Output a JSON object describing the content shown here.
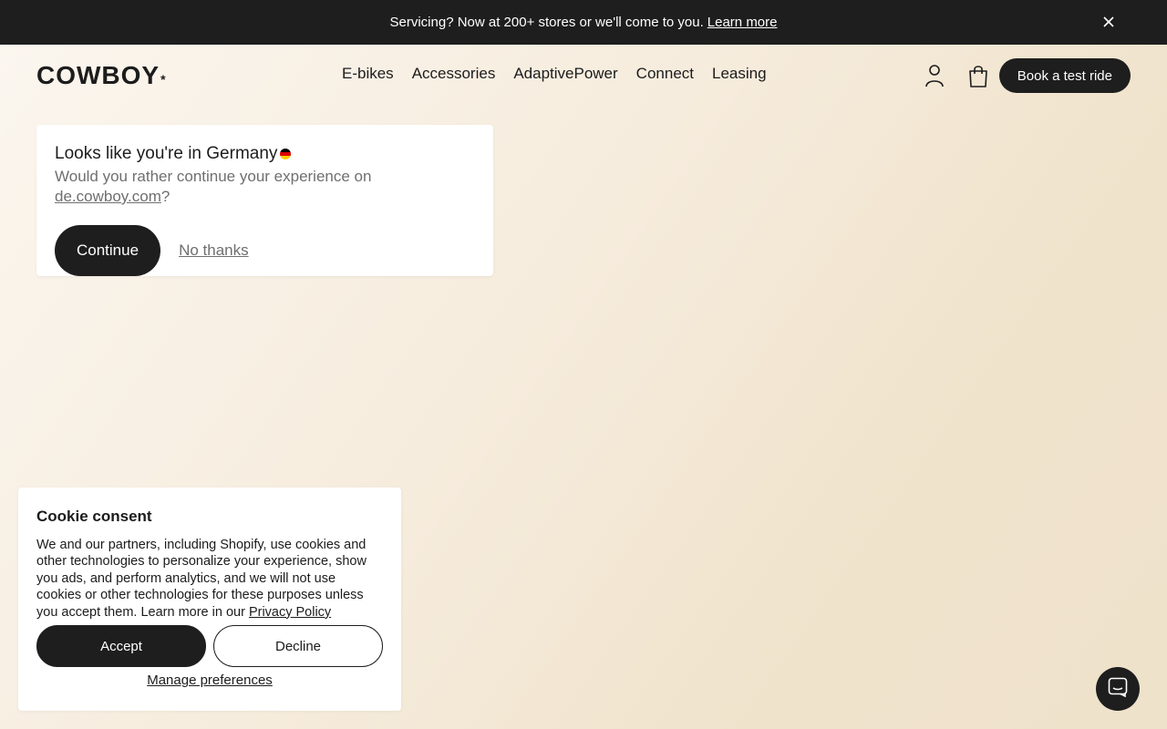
{
  "announcement": {
    "text": "Servicing? Now at 200+ stores or we'll come to you.",
    "link": "Learn more"
  },
  "header": {
    "logo": "COWBOY",
    "logo_mark": "*",
    "nav": [
      "E-bikes",
      "Accessories",
      "AdaptivePower",
      "Connect",
      "Leasing"
    ],
    "cta": "Book a test ride"
  },
  "geo_popup": {
    "title_prefix": "Looks like you're in",
    "country": "Germany",
    "subtitle_prefix": "Would you rather continue your experience on",
    "domain": "de.cowboy.com",
    "subtitle_suffix": "?",
    "continue_label": "Continue",
    "decline_label": "No thanks"
  },
  "cookie": {
    "title": "Cookie consent",
    "body": "We and our partners, including Shopify, use cookies and other technologies to personalize your experience, show you ads, and perform analytics, and we will not use cookies or other technologies for these purposes unless you accept them. Learn more in our",
    "policy_link": "Privacy Policy",
    "accept_label": "Accept",
    "decline_label": "Decline",
    "manage_label": "Manage preferences"
  },
  "icons": {
    "close": "close-icon",
    "account": "user-icon",
    "cart": "shopping-bag-icon",
    "chat": "chat-icon"
  },
  "colors": {
    "dark": "#1e1e1e",
    "muted": "#6f6f6f",
    "background": "#f6ecdd"
  }
}
